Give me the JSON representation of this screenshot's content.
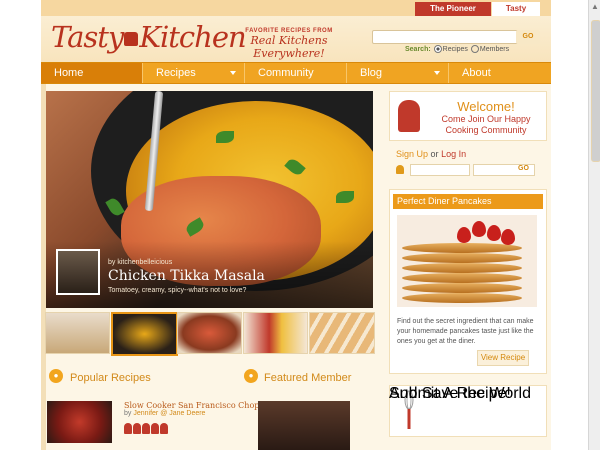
{
  "top_tabs": {
    "pioneer": "The Pioneer Woman",
    "tasty": "Tasty Kitchen"
  },
  "header": {
    "logo_part1": "Tasty",
    "logo_part2": "Kitchen",
    "tagline_small": "FAVORITE RECIPES FROM",
    "tagline_big": "Real Kitchens Everywhere!",
    "search_button": "GO",
    "search_for_label": "Search:",
    "search_option_recipes": "Recipes",
    "search_option_members": "Members"
  },
  "nav": {
    "items": [
      {
        "label": "Home"
      },
      {
        "label": "Recipes"
      },
      {
        "label": "Community"
      },
      {
        "label": "Blog"
      },
      {
        "label": "About"
      }
    ]
  },
  "hero": {
    "byline": "by kitchenbelleicious",
    "title": "Chicken Tikka Masala",
    "description": "Tomatoey, creamy, spicy--what's not to love?"
  },
  "sections": {
    "popular": "Popular Recipes",
    "featured": "Featured Member"
  },
  "popular_recipe": {
    "title": "Slow Cooker San Francisco Chops",
    "by_prefix": "by",
    "author": "Jennifer @ Jane Deere"
  },
  "sidebar": {
    "welcome_title": "Welcome!",
    "welcome_line1": "Come Join Our Happy",
    "welcome_line2": "Cooking Community",
    "signup": "Sign Up",
    "or": "or",
    "login": "Log In",
    "login_button": "GO",
    "panel_title": "Perfect Diner Pancakes",
    "panel_desc": "Find out the secret ingredient that can make your homemade pancakes taste just like the ones you get at the diner.",
    "view_recipe": "View Recipe",
    "submit_line1": "Submit A Recipe!",
    "submit_line2": "And Save the World"
  },
  "colors": {
    "accent_orange": "#f0a422",
    "brand_red": "#c0392b",
    "background": "#fdf6e6"
  }
}
